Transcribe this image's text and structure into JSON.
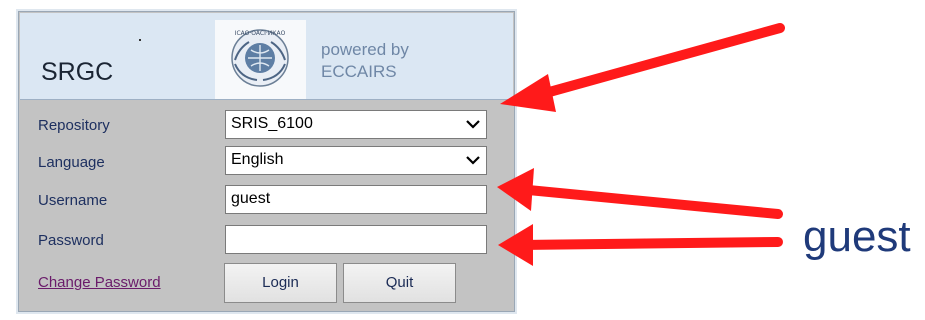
{
  "header": {
    "app_title": "SRGC",
    "powered_line1": "powered by",
    "powered_line2": "ECCAIRS",
    "logo_icon": "icao-emblem-icon"
  },
  "form": {
    "repository_label": "Repository",
    "repository_value": "SRIS_6100",
    "language_label": "Language",
    "language_value": "English",
    "username_label": "Username",
    "username_value": "guest",
    "password_label": "Password",
    "password_value": "",
    "change_password_link": "Change Password",
    "login_button": "Login",
    "quit_button": "Quit"
  },
  "annotation": {
    "side_text": "guest",
    "arrow_color": "#ff1a1a"
  }
}
